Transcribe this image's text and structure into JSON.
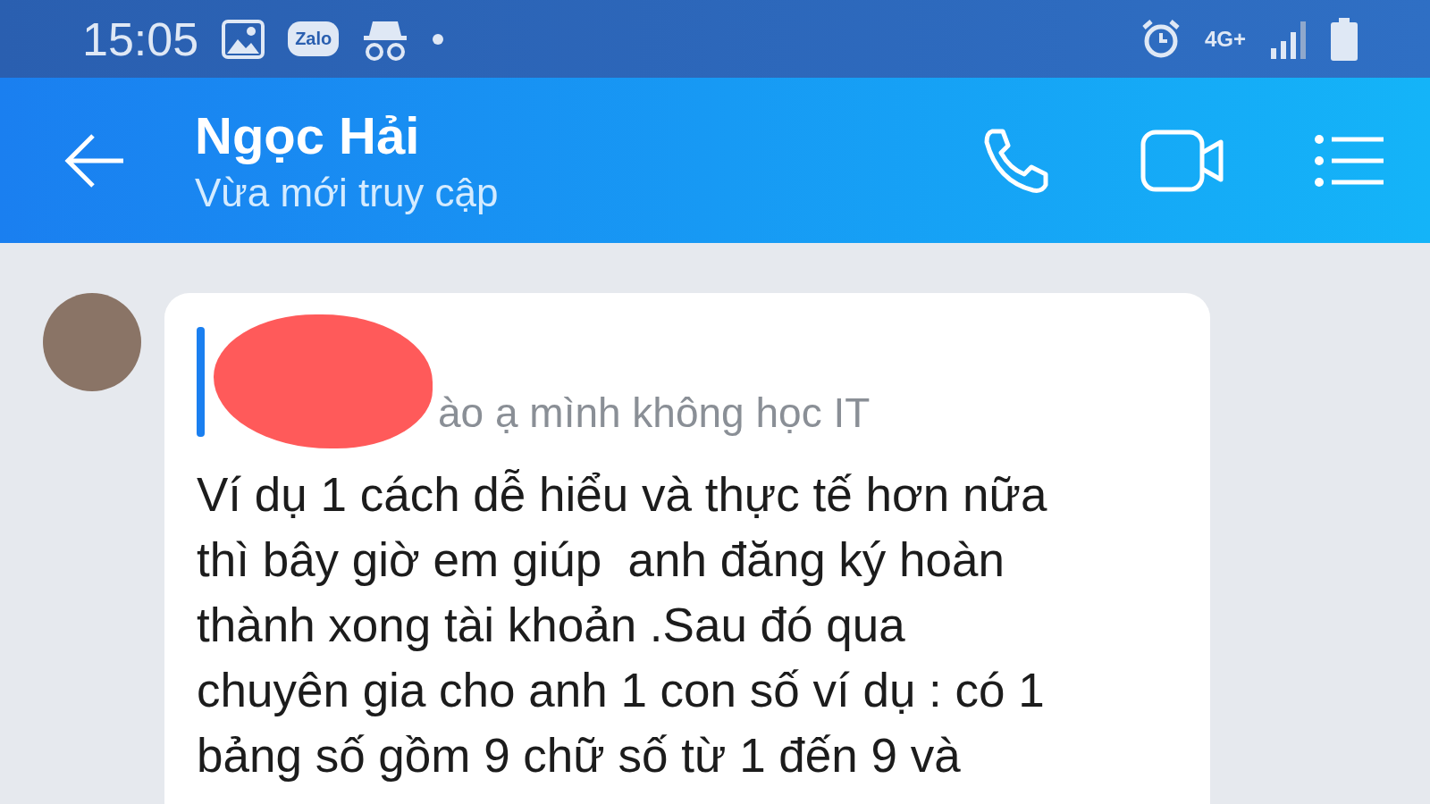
{
  "status_bar": {
    "time": "15:05",
    "app_badge": "Zalo",
    "network": "4G+"
  },
  "header": {
    "name": "Ngọc Hải",
    "status": "Vừa mới truy cập"
  },
  "message": {
    "quote": "ào ạ mình không học IT",
    "text": "Ví dụ 1 cách dễ hiểu và thực tế hơn nữa\nthì bây giờ em giúp  anh đăng ký hoàn\nthành xong tài khoản .Sau đó qua\nchuyên gia cho anh 1 con số ví dụ : có 1\nbảng số gồm 9 chữ số từ 1 đến 9 và"
  }
}
